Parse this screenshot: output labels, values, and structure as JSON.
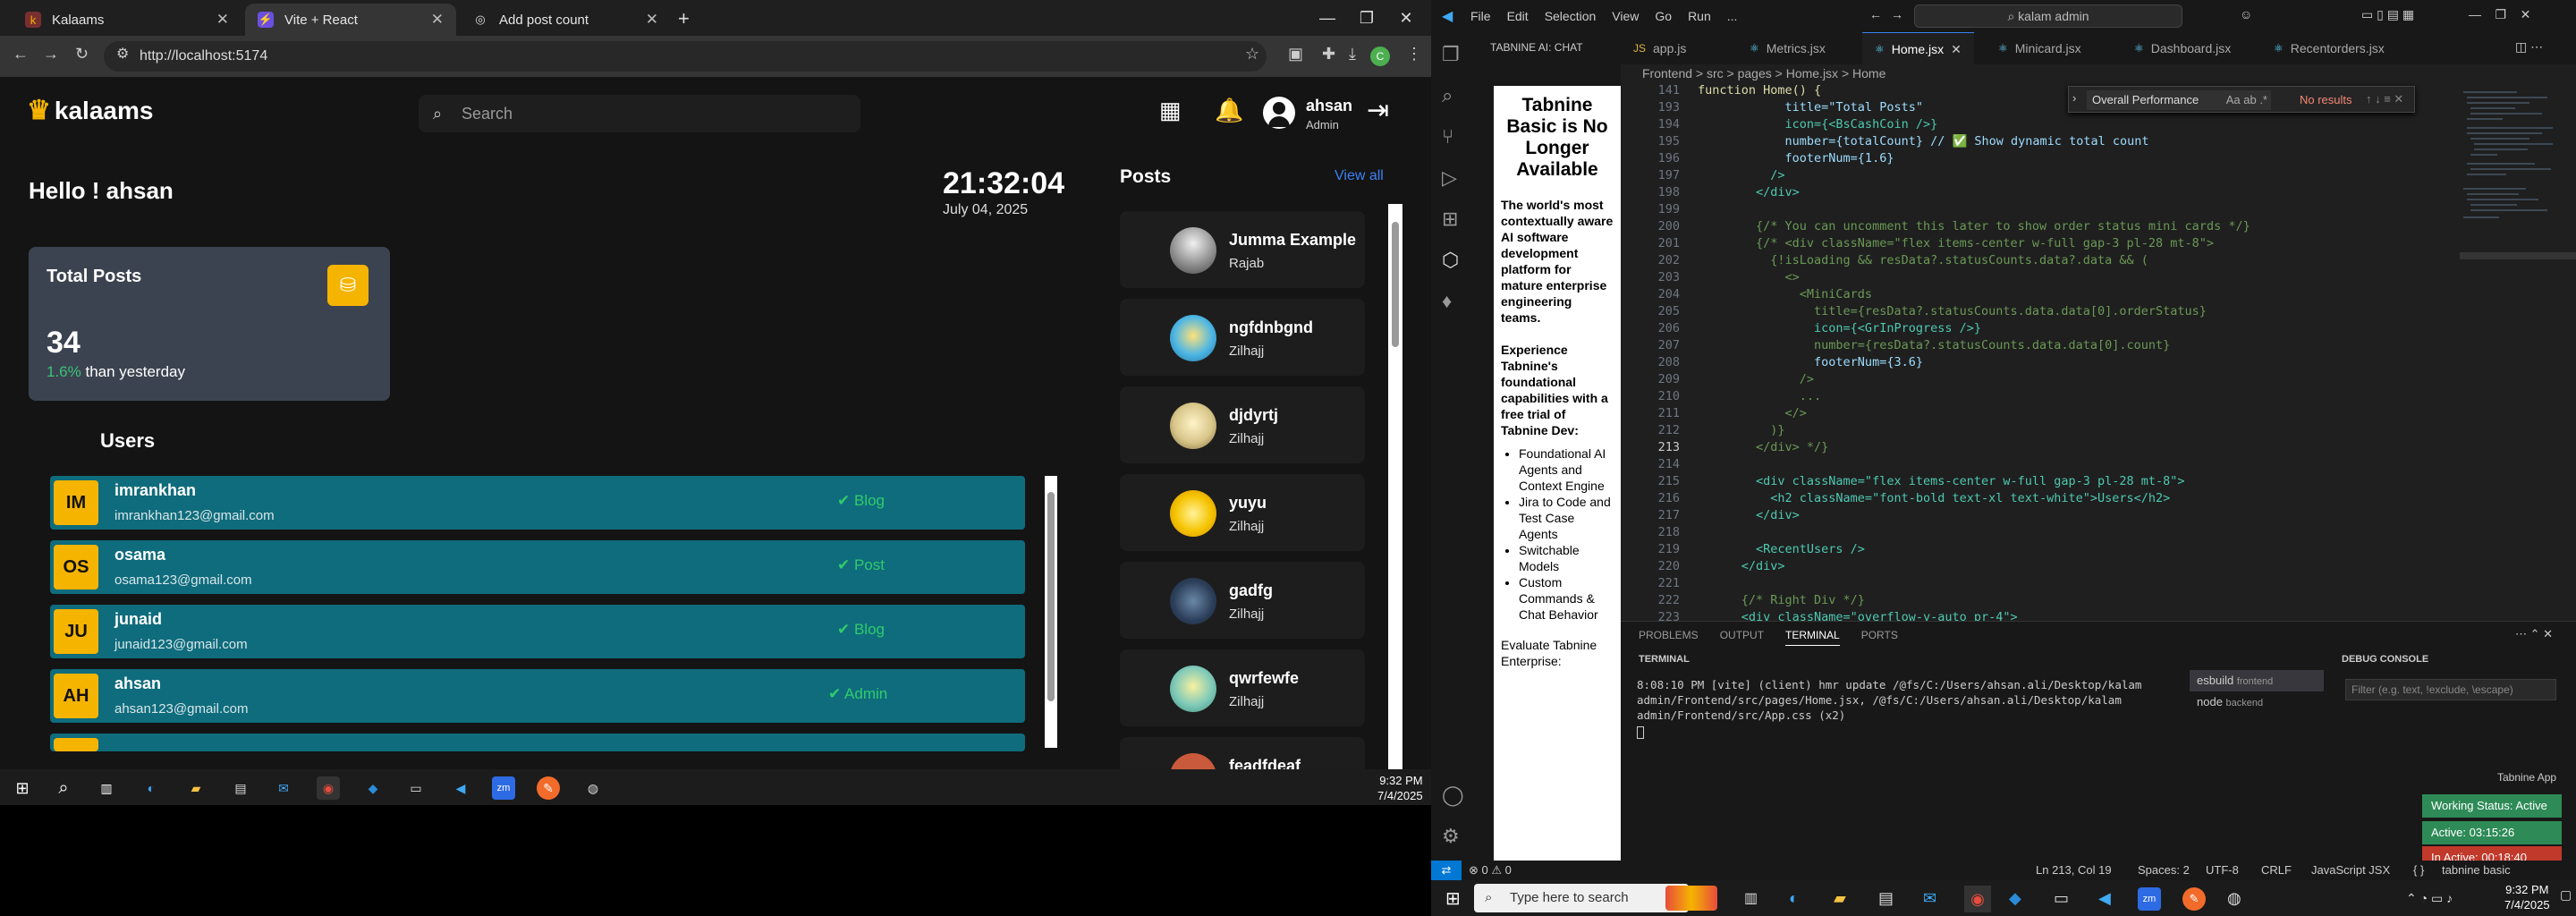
{
  "browser": {
    "tabs": [
      {
        "label": "Kalaams"
      },
      {
        "label": "Vite + React"
      },
      {
        "label": "Add post count"
      }
    ],
    "url": "http://localhost:5174"
  },
  "app": {
    "logo": "kalaams",
    "search_placeholder": "Search",
    "user": {
      "name": "ahsan",
      "role": "Admin"
    },
    "greeting": "Hello ! ahsan",
    "time": "21:32:04",
    "date": "July 04, 2025",
    "stats": {
      "title": "Total Posts",
      "count": "34",
      "change": "1.6%",
      "change_text": "than yesterday"
    },
    "users_title": "Users",
    "users": [
      {
        "initials": "IM",
        "name": "imrankhan",
        "email": "imrankhan123@gmail.com",
        "role": "Blog"
      },
      {
        "initials": "OS",
        "name": "osama",
        "email": "osama123@gmail.com",
        "role": "Post"
      },
      {
        "initials": "JU",
        "name": "junaid",
        "email": "junaid123@gmail.com",
        "role": "Blog"
      },
      {
        "initials": "AH",
        "name": "ahsan",
        "email": "ahsan123@gmail.com",
        "role": "Admin"
      }
    ],
    "posts_title": "Posts",
    "view_all": "View all",
    "posts": [
      {
        "title": "Jumma Example",
        "author": "Rajab"
      },
      {
        "title": "ngfdnbgnd",
        "author": "Zilhajj"
      },
      {
        "title": "djdyrtj",
        "author": "Zilhajj"
      },
      {
        "title": "yuyu",
        "author": "Zilhajj"
      },
      {
        "title": "gadfg",
        "author": "Zilhajj"
      },
      {
        "title": "qwrfewfe",
        "author": "Zilhajj"
      },
      {
        "title": "feadfdeaf",
        "author": ""
      }
    ]
  },
  "taskbar_left": {
    "time": "9:32 PM",
    "date": "7/4/2025"
  },
  "vscode": {
    "menu": [
      "File",
      "Edit",
      "Selection",
      "View",
      "Go",
      "Run",
      "..."
    ],
    "command_center": "kalam admin",
    "chat_title": "TABNINE AI: CHAT",
    "chat": {
      "heading": "Tabnine Basic is No Longer Available",
      "p1": "The world's most contextually aware AI software development platform for mature enterprise engineering teams.",
      "p2": "Experience Tabnine's foundational capabilities with a free trial of Tabnine Dev:",
      "features": [
        "Foundational AI Agents and Context Engine",
        "Jira to Code and Test Case Agents",
        "Switchable Models",
        "Custom Commands & Chat Behavior"
      ],
      "p3": "Evaluate Tabnine Enterprise:"
    },
    "tabs": [
      "app.js",
      "Metrics.jsx",
      "Home.jsx",
      "Minicard.jsx",
      "Dashboard.jsx",
      "Recentorders.jsx"
    ],
    "breadcrumbs": "Frontend > src > pages > Home.jsx > Home",
    "find": {
      "value": "Overall Performance",
      "result": "No results"
    },
    "code": [
      {
        "n": "141",
        "t": "function Home() {"
      },
      {
        "n": "193",
        "t": "            title=\"Total Posts\""
      },
      {
        "n": "194",
        "t": "            icon={<BsCashCoin />}"
      },
      {
        "n": "195",
        "t": "            number={totalCount} // ✅ Show dynamic total count"
      },
      {
        "n": "196",
        "t": "            footerNum={1.6}"
      },
      {
        "n": "197",
        "t": "          />"
      },
      {
        "n": "198",
        "t": "        </div>"
      },
      {
        "n": "199",
        "t": ""
      },
      {
        "n": "200",
        "t": "        {/* You can uncomment this later to show order status mini cards */}"
      },
      {
        "n": "201",
        "t": "        {/* <div className=\"flex items-center w-full gap-3 pl-28 mt-8\">"
      },
      {
        "n": "202",
        "t": "          {!isLoading && resData?.statusCounts.data?.data && ("
      },
      {
        "n": "203",
        "t": "            <>"
      },
      {
        "n": "204",
        "t": "              <MiniCards"
      },
      {
        "n": "205",
        "t": "                title={resData?.statusCounts.data.data[0].orderStatus}"
      },
      {
        "n": "206",
        "t": "                icon={<GrInProgress />}"
      },
      {
        "n": "207",
        "t": "                number={resData?.statusCounts.data.data[0].count}"
      },
      {
        "n": "208",
        "t": "                footerNum={3.6}"
      },
      {
        "n": "209",
        "t": "              />"
      },
      {
        "n": "210",
        "t": "              ..."
      },
      {
        "n": "211",
        "t": "            </>"
      },
      {
        "n": "212",
        "t": "          )}"
      },
      {
        "n": "213",
        "t": "        </div> */}"
      },
      {
        "n": "214",
        "t": ""
      },
      {
        "n": "215",
        "t": "        <div className=\"flex items-center w-full gap-3 pl-28 mt-8\">"
      },
      {
        "n": "216",
        "t": "          <h2 className=\"font-bold text-xl text-white\">Users</h2>"
      },
      {
        "n": "217",
        "t": "        </div>"
      },
      {
        "n": "218",
        "t": ""
      },
      {
        "n": "219",
        "t": "        <RecentUsers />"
      },
      {
        "n": "220",
        "t": "      </div>"
      },
      {
        "n": "221",
        "t": ""
      },
      {
        "n": "222",
        "t": "      {/* Right Div */}"
      },
      {
        "n": "223",
        "t": "      <div className=\"overflow-y-auto pr-4\">"
      }
    ],
    "panel_tabs": [
      "PROBLEMS",
      "OUTPUT",
      "TERMINAL",
      "PORTS"
    ],
    "terminal_label": "TERMINAL",
    "terminal_text": "8:08:10 PM [vite] (client) hmr update /@fs/C:/Users/ahsan.ali/Desktop/kalam admin/Frontend/src/pages/Home.jsx, /@fs/C:/Users/ahsan.ali/Desktop/kalam admin/Frontend/src/App.css (x2)",
    "terminals": [
      {
        "name": "esbuild",
        "folder": "frontend"
      },
      {
        "name": "node",
        "folder": "backend"
      }
    ],
    "debug_label": "DEBUG CONSOLE",
    "debug_placeholder": "Filter (e.g. text, !exclude, \\escape)",
    "tabnine_app": "Tabnine App",
    "status_badges": {
      "working": "Working Status: Active",
      "active": "Active: 03:15:26",
      "inactive": "In Active: 00:18:40"
    },
    "statusbar": {
      "errors": "⊗ 0 ⚠ 0",
      "position": "Ln 213, Col 19",
      "spaces": "Spaces: 2",
      "encoding": "UTF-8",
      "eol": "CRLF",
      "lang": "JavaScript JSX",
      "tabnine": "tabnine basic"
    }
  },
  "taskbar_right": {
    "search_placeholder": "Type here to search",
    "time": "9:32 PM",
    "date": "7/4/2025"
  }
}
